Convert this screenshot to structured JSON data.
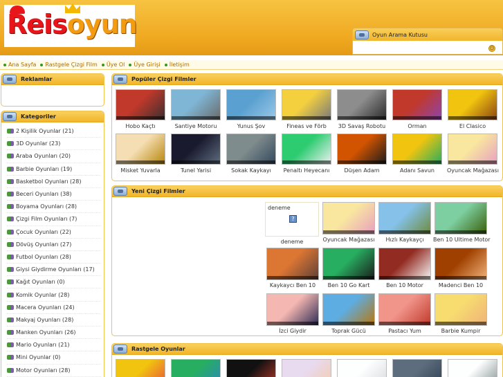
{
  "header": {
    "logo_text_part1": "Reis",
    "logo_text_part2": "oyun",
    "search_title": "Oyun Arama Kutusu"
  },
  "nav": {
    "items": [
      "Ana Sayfa",
      "Rastgele Çizgi Film",
      "Üye Ol",
      "Üye Girişi",
      "İletişim"
    ]
  },
  "sidebar": {
    "ads_title": "Reklamlar",
    "categories_title": "Kategoriler",
    "categories": [
      "2 Kişilik Oyunlar (21)",
      "3D Oyunlar (23)",
      "Araba Oyunları (20)",
      "Barbie Oyunları (19)",
      "Basketbol Oyunları (28)",
      "Beceri Oyunları (38)",
      "Boyama Oyunları (28)",
      "Çizgi Film Oyunları (7)",
      "Çocuk Oyunları (22)",
      "Dövüş Oyunları (27)",
      "Futbol Oyunları (28)",
      "Giysi Giydirme Oyunları (17)",
      "Kağıt Oyunları (0)",
      "Komik Oyunlar (28)",
      "Macera Oyunları (24)",
      "Makyaj Oyunları (28)",
      "Manken Oyunları (26)",
      "Mario Oyunları (21)",
      "Mini Oyunlar (0)",
      "Motor Oyunları (28)"
    ]
  },
  "popular": {
    "title": "Popüler Çizgi Filmler",
    "items": [
      {
        "label": "Hobo Kaçtı",
        "c1": "#c0392b",
        "c2": "#3b2f2f"
      },
      {
        "label": "Santiye Motoru",
        "c1": "#7fb6d6",
        "c2": "#6b6b6b"
      },
      {
        "label": "Yunus Şov",
        "c1": "#5aa0d0",
        "c2": "#9ac8e8"
      },
      {
        "label": "Fineas ve Förb",
        "c1": "#f4d03f",
        "c2": "#7a7a7a"
      },
      {
        "label": "3D Savaş Robotu",
        "c1": "#8d8d8d",
        "c2": "#2b2b2b"
      },
      {
        "label": "Orman",
        "c1": "#c0392b",
        "c2": "#8e44ad"
      },
      {
        "label": "El Clasico",
        "c1": "#f1c40f",
        "c2": "#8b4513"
      },
      {
        "label": "Misket Yuvarla",
        "c1": "#f5deb3",
        "c2": "#b8860b"
      },
      {
        "label": "Tunel Yarisi",
        "c1": "#1a1a2e",
        "c2": "#5d6d7e"
      },
      {
        "label": "Sokak Kaykayı",
        "c1": "#7f8c8d",
        "c2": "#34495e"
      },
      {
        "label": "Penaltı Heyecanı",
        "c1": "#2ecc71",
        "c2": "#ecf0f1"
      },
      {
        "label": "Düşen Adam",
        "c1": "#d35400",
        "c2": "#1c1c1c"
      },
      {
        "label": "Adanı Savun",
        "c1": "#f1c40f",
        "c2": "#27ae60"
      },
      {
        "label": "Oyuncak Mağazası",
        "c1": "#f9e79f",
        "c2": "#e8a0bf"
      }
    ]
  },
  "new": {
    "title": "Yeni Çizgi Filmler",
    "deneme_text": "deneme",
    "deneme_label": "deneme",
    "items": [
      {
        "label": "Oyuncak Mağazası",
        "c1": "#f9e79f",
        "c2": "#e8a0bf"
      },
      {
        "label": "Hızlı Kaykayçı",
        "c1": "#85c1e9",
        "c2": "#6e8b3d"
      },
      {
        "label": "Ben 10 Ultime Motor",
        "c1": "#7dcea0",
        "c2": "#3a5f0b"
      },
      {
        "label": "Kaykaycı Ben 10",
        "c1": "#dc7633",
        "c2": "#5d4037"
      },
      {
        "label": "Ben 10 Go Kart",
        "c1": "#27ae60",
        "c2": "#1b1b1b"
      },
      {
        "label": "Ben 10 Motor",
        "c1": "#922b21",
        "c2": "#f5f5f5"
      },
      {
        "label": "Madenci Ben 10",
        "c1": "#a04000",
        "c2": "#f0b27a"
      },
      {
        "label": "İzci Giydir",
        "c1": "#f5b7b1",
        "c2": "#2c2c54"
      },
      {
        "label": "Toprak Gücü",
        "c1": "#5dade2",
        "c2": "#b9770e"
      },
      {
        "label": "Pastacı Yum",
        "c1": "#f1948a",
        "c2": "#c0392b"
      },
      {
        "label": "Barbie Kumpir",
        "c1": "#f7dc6f",
        "c2": "#f0b27a"
      }
    ]
  },
  "random": {
    "title": "Rastgele Oyunlar",
    "items": [
      {
        "c1": "#f1c40f",
        "c2": "#e74c3c"
      },
      {
        "c1": "#27ae60",
        "c2": "#2e86c1"
      },
      {
        "c1": "#111111",
        "c2": "#c0392b"
      },
      {
        "c1": "#e8daef",
        "c2": "#f5cba7"
      },
      {
        "c1": "#fdfefe",
        "c2": "#d5d8dc"
      },
      {
        "c1": "#5d6d7e",
        "c2": "#2c3e50"
      },
      {
        "c1": "#fdfefe",
        "c2": "#7f8c8d"
      },
      {
        "c1": "#aed6f1",
        "c2": "#d6eaf8"
      }
    ]
  }
}
